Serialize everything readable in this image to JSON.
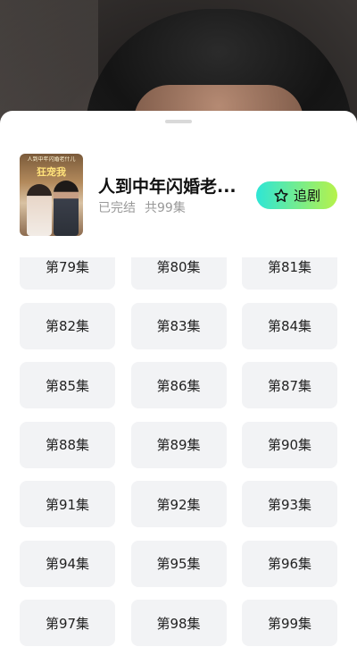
{
  "drama": {
    "title": "人到中年闪婚老...",
    "status": "已完结",
    "episode_count": "共99集",
    "cover_text_top": "人到中年闪婚老什儿",
    "cover_text_main": "狂宠我"
  },
  "follow_button": {
    "label": "追剧",
    "icon": "star-outline-icon"
  },
  "episodes": [
    "第79集",
    "第80集",
    "第81集",
    "第82集",
    "第83集",
    "第84集",
    "第85集",
    "第86集",
    "第87集",
    "第88集",
    "第89集",
    "第90集",
    "第91集",
    "第92集",
    "第93集",
    "第94集",
    "第95集",
    "第96集",
    "第97集",
    "第98集",
    "第99集"
  ],
  "colors": {
    "sheet_bg": "#ffffff",
    "episode_bg": "#f2f3f5",
    "follow_gradient_start": "#2ee6d6",
    "follow_gradient_end": "#b7f24a",
    "meta_text": "#9a9a9a"
  }
}
